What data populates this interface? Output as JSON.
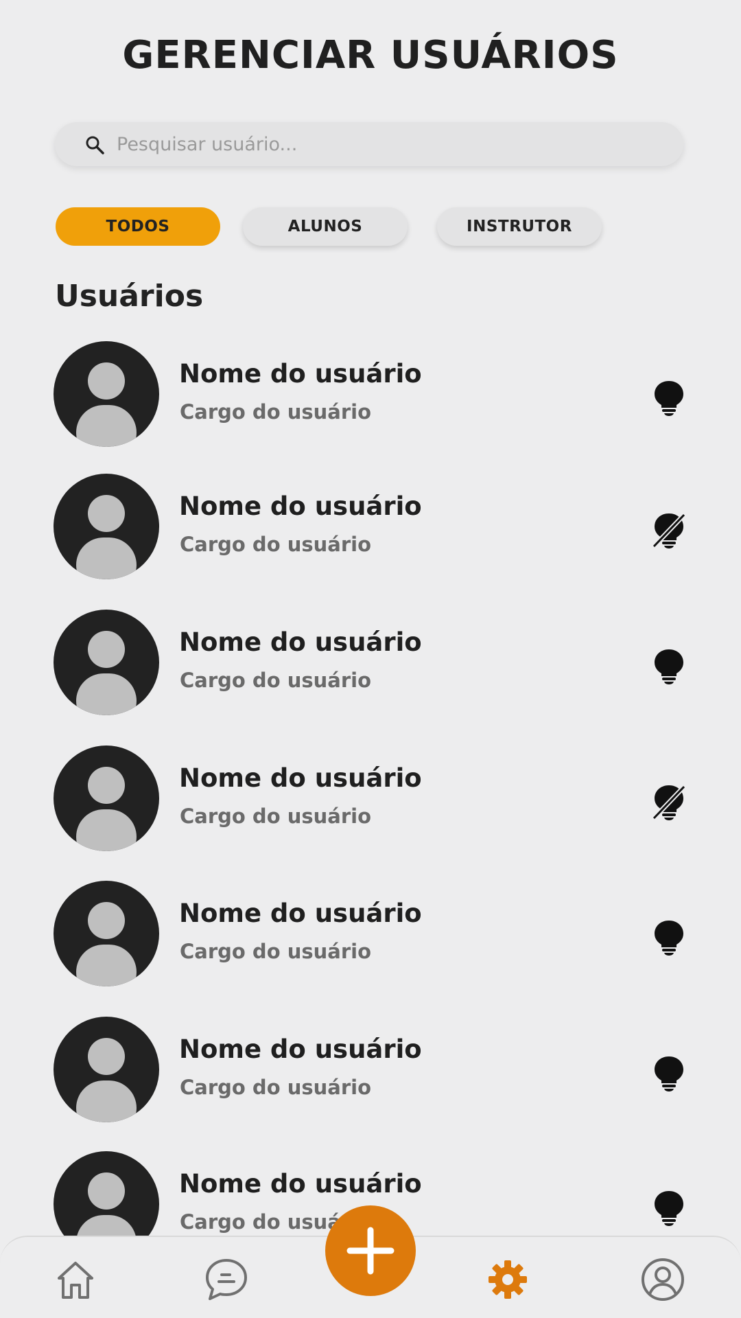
{
  "header": {
    "title": "GERENCIAR USUÁRIOS"
  },
  "search": {
    "placeholder": "Pesquisar usuário..."
  },
  "filters": [
    {
      "label": "TODOS",
      "active": true
    },
    {
      "label": "ALUNOS",
      "active": false
    },
    {
      "label": "INSTRUTOR",
      "active": false
    }
  ],
  "section": {
    "title": "Usuários"
  },
  "users": [
    {
      "name": "Nome do usuário",
      "role": "Cargo do usuário",
      "status_icon": "lightbulb-icon"
    },
    {
      "name": "Nome do usuário",
      "role": "Cargo do usuário",
      "status_icon": "lightbulb-off-icon"
    },
    {
      "name": "Nome do usuário",
      "role": "Cargo do usuário",
      "status_icon": "lightbulb-icon"
    },
    {
      "name": "Nome do usuário",
      "role": "Cargo do usuário",
      "status_icon": "lightbulb-off-icon"
    },
    {
      "name": "Nome do usuário",
      "role": "Cargo do usuário",
      "status_icon": "lightbulb-icon"
    },
    {
      "name": "Nome do usuário",
      "role": "Cargo do usuário",
      "status_icon": "lightbulb-icon"
    },
    {
      "name": "Nome do usuário",
      "role": "Cargo do usuário",
      "status_icon": "lightbulb-icon"
    }
  ],
  "nav": {
    "items": [
      "home-icon",
      "chat-icon",
      "add-icon",
      "settings-icon",
      "profile-icon"
    ],
    "active": "settings-icon"
  },
  "colors": {
    "accent": "#f0a00a",
    "fab": "#dd7a0c",
    "active_nav": "#dd7a0c",
    "background": "#ededee"
  }
}
